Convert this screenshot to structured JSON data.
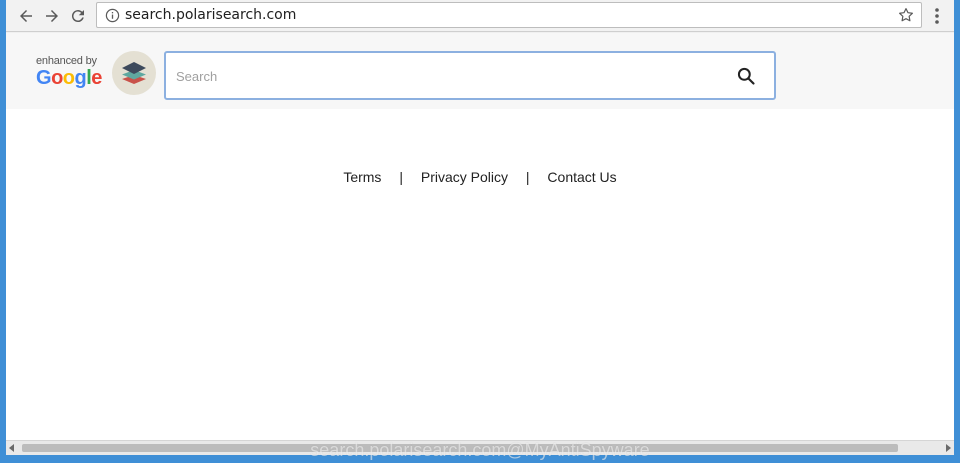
{
  "browser": {
    "url": "search.polarisearch.com",
    "icons": [
      "back-icon",
      "forward-icon",
      "reload-icon",
      "info-icon",
      "star-icon",
      "menu-icon"
    ]
  },
  "header": {
    "badge": {
      "enhanced_by": "enhanced by",
      "google": [
        "G",
        "o",
        "o",
        "g",
        "l",
        "e"
      ]
    },
    "search": {
      "placeholder": "Search",
      "value": ""
    }
  },
  "footer": {
    "links": [
      "Terms",
      "Privacy Policy",
      "Contact Us"
    ],
    "separator": "|"
  },
  "watermark": "search.polarisearch.com@MyAntiSpyware",
  "colors": {
    "window_accent": "#3f8fd6",
    "search_border": "#8cb0e0",
    "google_blue": "#4285F4",
    "google_red": "#EA4335",
    "google_yellow": "#FBBC05",
    "google_green": "#34A853"
  }
}
